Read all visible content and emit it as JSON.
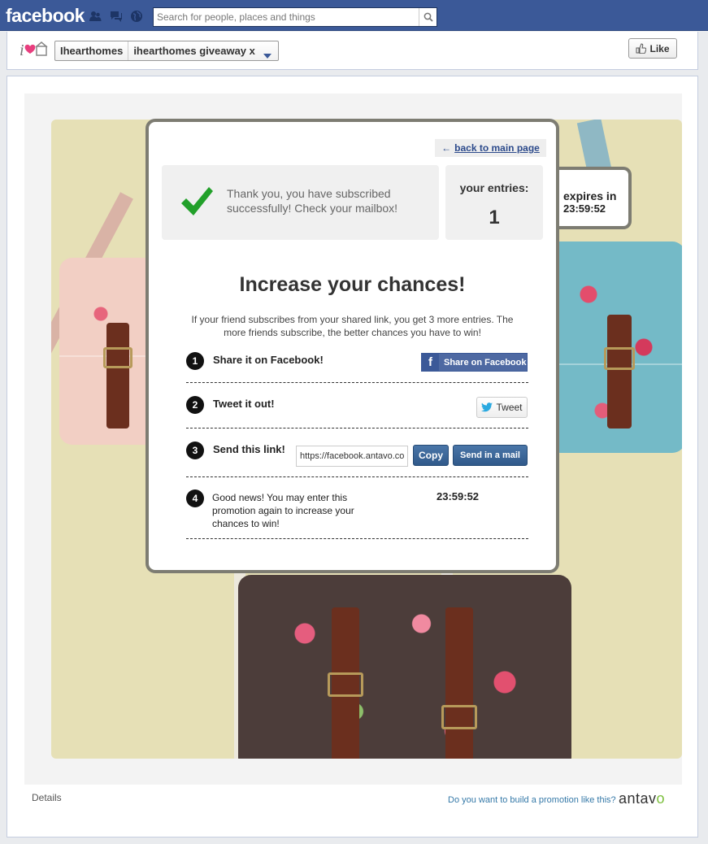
{
  "topbar": {
    "brand": "facebook",
    "search_placeholder": "Search for people, places and things"
  },
  "page_header": {
    "crumb_page": "Ihearthomes",
    "crumb_tab": "ihearthomes giveaway x",
    "like_label": "Like"
  },
  "promo": {
    "back_link": "back to main page",
    "back_arrow": "←",
    "thanks_text": "Thank you, you have subscribed successfully! Check your mailbox!",
    "entries_label": "your entries:",
    "entries_value": "1",
    "expires_label": "expires in",
    "expires_time": "23:59:52",
    "headline": "Increase your chances!",
    "description": "If your friend subscribes from your shared link, you get 3 more entries. The more friends subscribe, the better chances you have to win!",
    "steps": [
      {
        "number": "1",
        "title": "Share it on Facebook!",
        "action": "Share on Facebook"
      },
      {
        "number": "2",
        "title": "Tweet it out!",
        "action": "Tweet"
      },
      {
        "number": "3",
        "title": "Send this link!",
        "link_value": "https://facebook.antavo.co",
        "copy_label": "Copy",
        "mail_label": "Send in a mail"
      },
      {
        "number": "4",
        "text": "Good news! You may enter this promotion again to increase your chances to win!",
        "timer": "23:59:52"
      }
    ]
  },
  "footer": {
    "details": "Details",
    "promo_link": "Do you want to build a promotion like this?",
    "brand_a": "antav",
    "brand_o": "o"
  },
  "colors": {
    "fb_blue": "#3b5998",
    "button_blue": "#30598a",
    "check_green": "#22a02a",
    "frame_gray": "#7d7c72"
  }
}
